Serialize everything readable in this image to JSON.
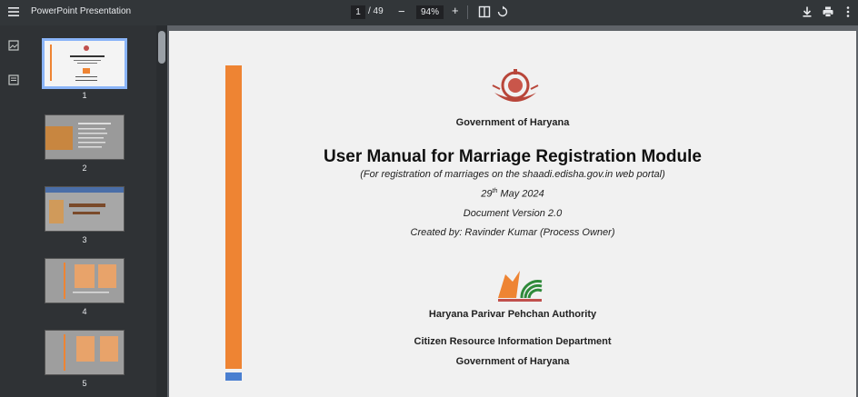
{
  "toolbar": {
    "title": "PowerPoint Presentation",
    "current_page": "1",
    "total_pages": "/ 49",
    "zoom": "94%",
    "zoom_out": "−",
    "zoom_in": "+"
  },
  "thumbnails": [
    {
      "label": "1",
      "selected": true
    },
    {
      "label": "2",
      "selected": false
    },
    {
      "label": "3",
      "selected": false
    },
    {
      "label": "4",
      "selected": false
    },
    {
      "label": "5",
      "selected": false
    }
  ],
  "slide": {
    "government": "Government of Haryana",
    "title": "User Manual for Marriage Registration Module",
    "subtitle": "(For registration of marriages on the shaadi.edisha.gov.in web portal)",
    "date_day": "29",
    "date_suffix": "th",
    "date_rest": " May 2024",
    "version": "Document Version 2.0",
    "created_by": "Created by: Ravinder Kumar (Process Owner)",
    "authority": "Haryana Parivar Pehchan Authority",
    "department": "Citizen Resource Information Department",
    "government_footer": "Government of Haryana"
  },
  "colors": {
    "accent_orange": "#ee8433",
    "accent_blue": "#4a7fd0",
    "selection": "#8ab4f8"
  }
}
